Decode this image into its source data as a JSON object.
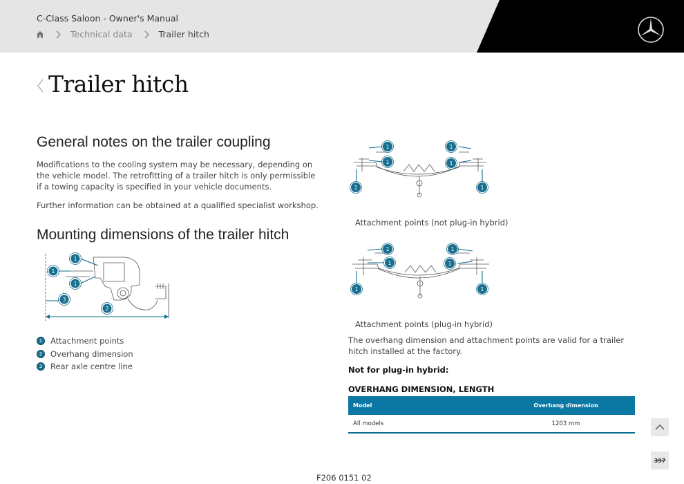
{
  "header": {
    "app_title": "C-Class Saloon - Owner's Manual",
    "breadcrumb": {
      "home_icon": "home-icon",
      "items": [
        "Technical data",
        "Trailer hitch"
      ]
    },
    "logo_icon": "mercedes-star-logo",
    "colors": {
      "header_bg": "#e5e5e5",
      "header_black": "#000000"
    }
  },
  "page": {
    "title": "Trailer hitch",
    "back_icon": "chevron-left-icon"
  },
  "general_notes": {
    "heading": "General notes on the trailer coupling",
    "paragraphs": [
      "Modifications to the cooling system may be necessary, depending on the vehicle model. The retrofitting of a trailer hitch is only permissible if a towing capacity is specified in your vehicle documents.",
      "Further information can be obtained at a qualified specialist workshop."
    ]
  },
  "mounting": {
    "heading": "Mounting dimensions of the trailer hitch",
    "diagram_callouts": [
      "1",
      "1",
      "1",
      "2",
      "3"
    ],
    "legend": [
      {
        "num": "1",
        "label": "Attachment points"
      },
      {
        "num": "2",
        "label": "Overhang dimension"
      },
      {
        "num": "3",
        "label": "Rear axle centre line"
      }
    ]
  },
  "figures": {
    "callout_label": "1",
    "caption_1": "Attachment points (not plug-in hybrid)",
    "caption_2": "Attachment points (plug-in hybrid)"
  },
  "overhang": {
    "note": "The overhang dimension and attachment points are valid for a trailer hitch installed at the factory.",
    "not_for_label": "Not for plug-in hybrid:",
    "table_title": "OVERHANG DIMENSION, LENGTH",
    "columns": [
      "Model",
      "Overhang dimension"
    ],
    "rows": [
      [
        "All models",
        "1203 mm"
      ]
    ],
    "accent_color": "#0b78a3"
  },
  "controls": {
    "scroll_top_icon": "chevron-up-icon",
    "page_number": "397"
  },
  "footer": {
    "code": "F206 0151 02"
  }
}
